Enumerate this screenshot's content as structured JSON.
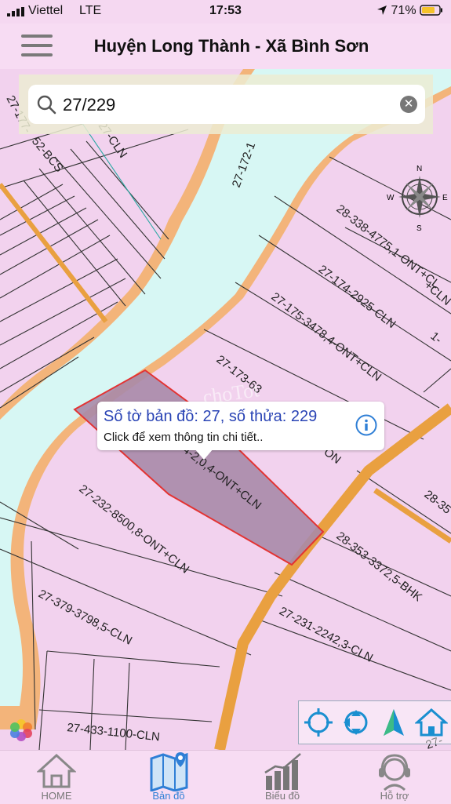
{
  "status_bar": {
    "carrier": "Viettel",
    "network": "LTE",
    "time": "17:53",
    "battery": "71%",
    "icons": [
      "signal-icon",
      "location-icon",
      "battery-icon"
    ]
  },
  "header": {
    "title": "Huyện Long Thành - Xã Bình Sơn",
    "menu_icon": "hamburger-menu-icon"
  },
  "search": {
    "value": "27/229",
    "icon": "search-icon",
    "clear_icon": "clear-icon"
  },
  "compass": {
    "n": "N",
    "s": "S",
    "e": "E",
    "w": "W"
  },
  "map": {
    "watermark": "choTot",
    "parcel_labels": [
      "27-177-",
      "52-BCS",
      "27-CLN",
      "27-172-1",
      "28-338-4775,1-ONT+CL",
      "27-174-2925-CLN",
      "27-175-3478,4-ONT+CLN",
      "27-173-63",
      "ON",
      "4-2,0,4-ONT+CLN",
      "27-232-8500,8-ONT+CLN",
      "28-353-3372,5-BHK",
      "28-35",
      "27-379-3798,5-CLN",
      "27-231-2242,3-CLN",
      "27-433-1100-CLN",
      "1-",
      "+CLN",
      "27-"
    ]
  },
  "popup": {
    "title": "Số tờ bản đồ: 27, số thửa: 229",
    "subtitle": "Click để xem thông tin chi tiết..",
    "info_icon": "info-icon"
  },
  "map_tools": [
    "locate-icon",
    "refresh-location-icon",
    "navigate-arrow-icon",
    "home-icon"
  ],
  "tabs": [
    {
      "label": "HOME",
      "icon": "home-icon",
      "active": false
    },
    {
      "label": "Bản đồ",
      "icon": "map-icon",
      "active": true
    },
    {
      "label": "Biểu đồ",
      "icon": "bar-chart-icon",
      "active": false
    },
    {
      "label": "Hỗ trợ",
      "icon": "support-icon",
      "active": false
    }
  ],
  "colors": {
    "parcel_fill": "#f2d2ee",
    "river": "#d7f7f4",
    "road": "#f0a84a",
    "selected_parcel": "#a98aa8",
    "selected_border": "#e33333",
    "active_tab": "#2f7fd6"
  }
}
